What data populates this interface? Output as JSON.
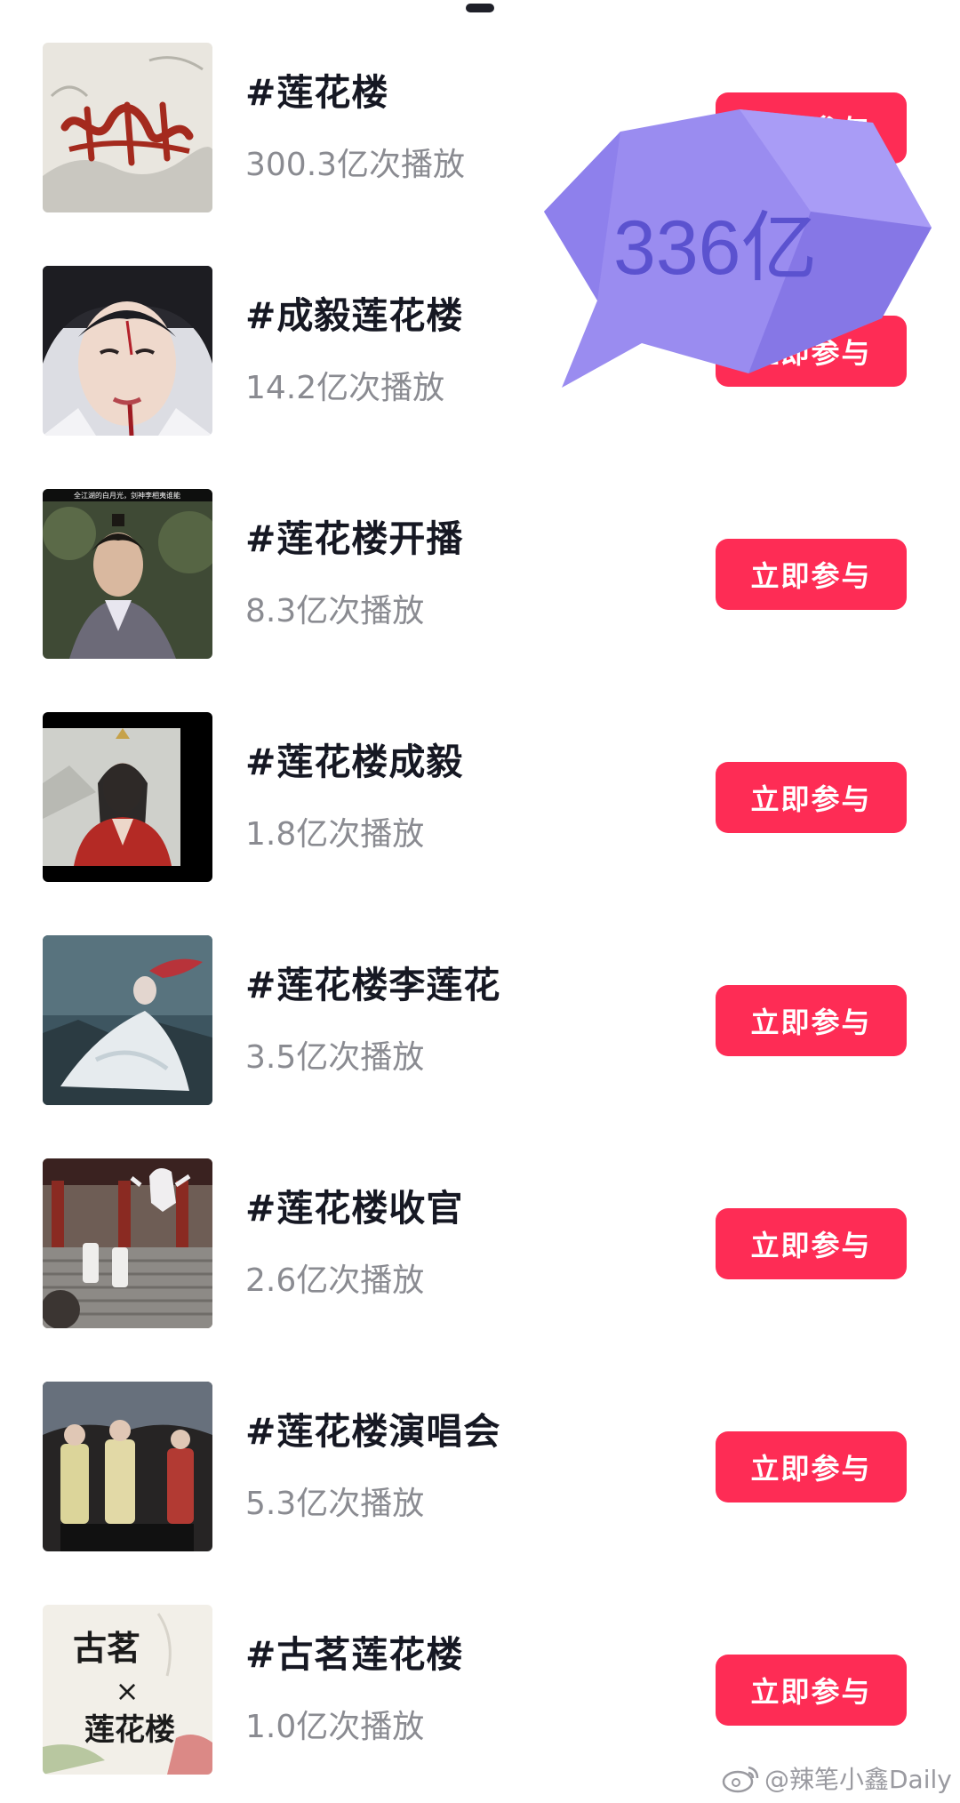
{
  "topics": [
    {
      "title": "#莲花楼",
      "plays": "300.3亿次播放",
      "button": "立即参与",
      "thumb": "calligraphy-poster"
    },
    {
      "title": "#成毅莲花楼",
      "plays": "14.2亿次播放",
      "button": "立即参与",
      "thumb": "portrait-closeup"
    },
    {
      "title": "#莲花楼开播",
      "plays": "8.3亿次播放",
      "button": "立即参与",
      "thumb": "video-still-forest",
      "thumb_caption": "全江湖的白月光，剑神李相夷谁能"
    },
    {
      "title": "#莲花楼成毅",
      "plays": "1.8亿次播放",
      "button": "立即参与",
      "thumb": "portrait-red-robe"
    },
    {
      "title": "#莲花楼李莲花",
      "plays": "3.5亿次播放",
      "button": "立即参与",
      "thumb": "figure-sitting-dusk"
    },
    {
      "title": "#莲花楼收官",
      "plays": "2.6亿次播放",
      "button": "立即参与",
      "thumb": "palace-stairs-scene"
    },
    {
      "title": "#莲花楼演唱会",
      "plays": "5.3亿次播放",
      "button": "立即参与",
      "thumb": "concert-stage"
    },
    {
      "title": "#古茗莲花楼",
      "plays": "1.0亿次播放",
      "button": "立即参与",
      "thumb": "brand-collab-poster",
      "thumb_text": {
        "brand": "古茗",
        "cross": "×",
        "show": "莲花楼"
      }
    }
  ],
  "overlay": {
    "bubble_text": "336亿",
    "bubble_color": "#9a8cf0"
  },
  "watermark": {
    "icon": "weibo-icon",
    "text": "@辣笔小鑫Daily"
  },
  "colors": {
    "accent": "#fe2c55",
    "title": "#161823",
    "subtitle": "#8a8b91"
  }
}
